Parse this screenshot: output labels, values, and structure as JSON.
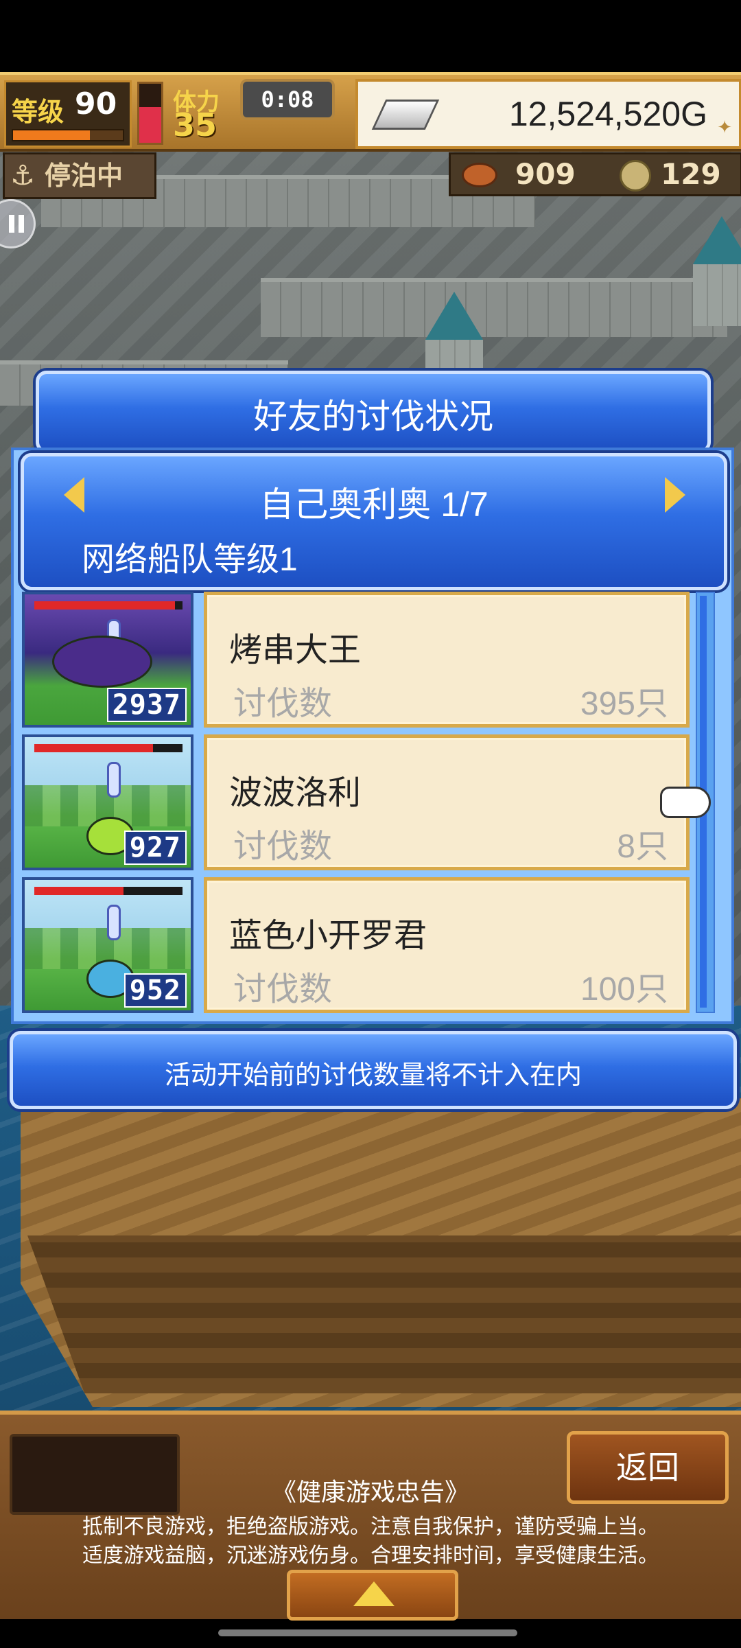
{
  "hud": {
    "level_label": "等级",
    "level": "90",
    "level_progress": 0.7,
    "hp_fraction": 0.6,
    "stamina_label": "体力",
    "stamina": "35",
    "timer": "0:08",
    "gold": "12,524,520G",
    "status": "停泊中",
    "meat": "909",
    "coins": "129"
  },
  "dialog": {
    "title": "好友的讨伐状况",
    "friend_name": "自己奥利奥 1/7",
    "fleet_level": "网络船队等级1",
    "rows": [
      {
        "name": "烤串大王",
        "kill_label": "讨伐数",
        "kills": "395只",
        "thumb_count": "2937",
        "hp_fraction": 0.95
      },
      {
        "name": "波波洛利",
        "kill_label": "讨伐数",
        "kills": "8只",
        "thumb_count": "927",
        "hp_fraction": 0.8
      },
      {
        "name": "蓝色小开罗君",
        "kill_label": "讨伐数",
        "kills": "100只",
        "thumb_count": "952",
        "hp_fraction": 0.6
      }
    ],
    "notice": "活动开始前的讨伐数量将不计入在内"
  },
  "bottom": {
    "back_label": "返回",
    "health_title": "《健康游戏忠告》",
    "health_line1": "抵制不良游戏，拒绝盗版游戏。注意自我保护，谨防受骗上当。",
    "health_line2": "适度游戏益脑，沉迷游戏伤身。合理安排时间，享受健康生活。"
  }
}
